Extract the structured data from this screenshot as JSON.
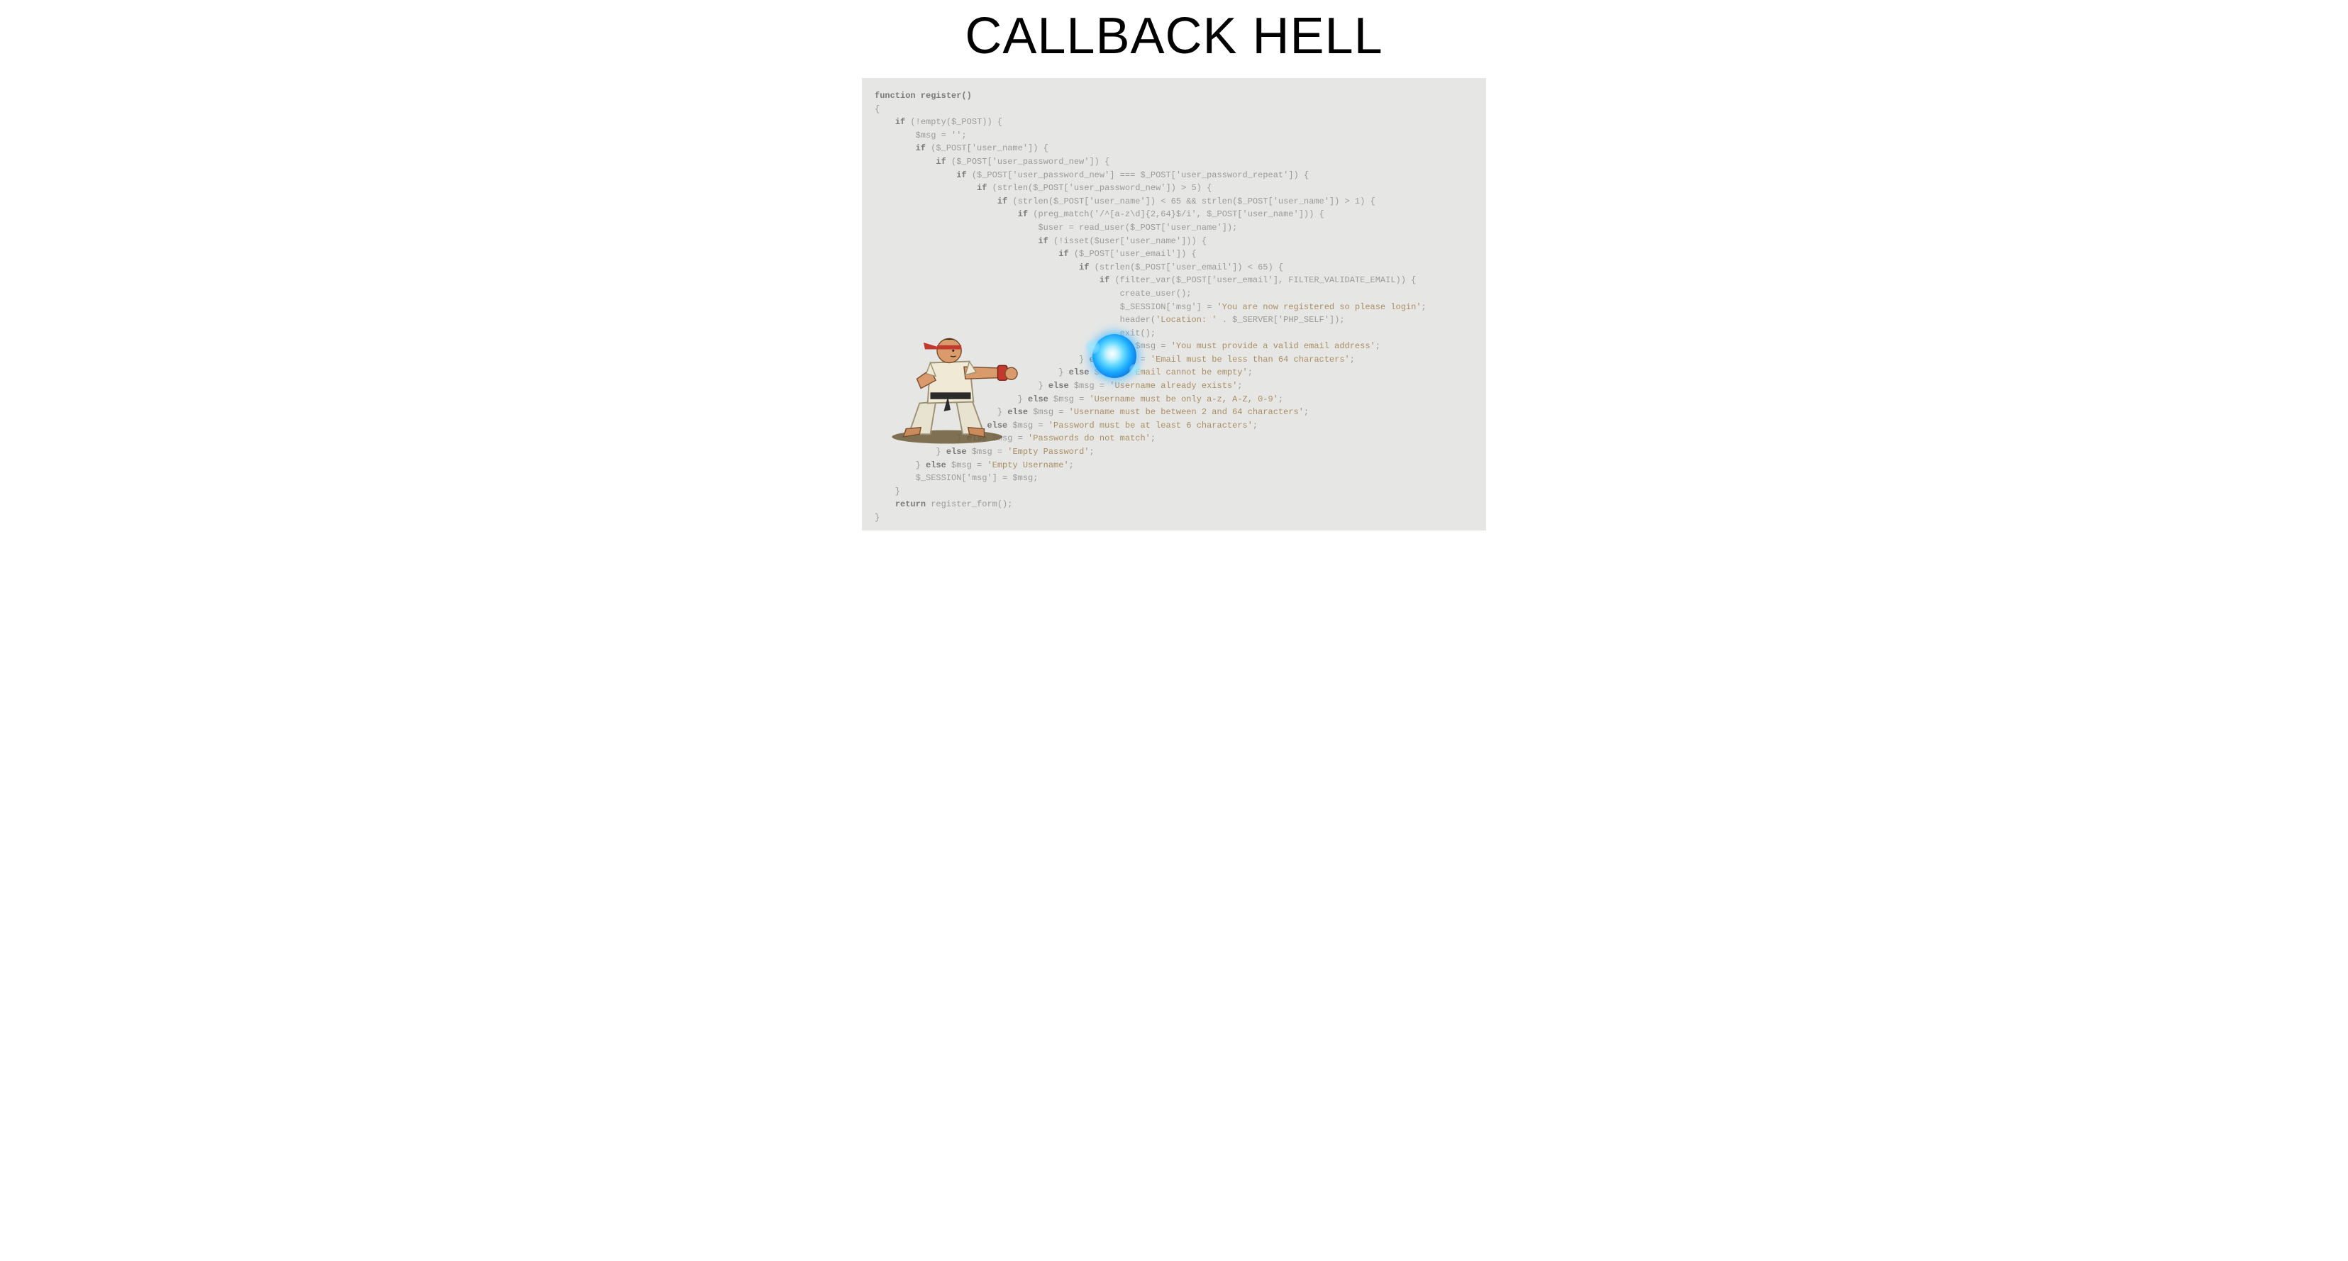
{
  "title": "CALLBACK HELL",
  "code": {
    "l01": "function register()",
    "l02": "{",
    "l03_kw": "if",
    "l03_rest": " (!empty($_POST)) {",
    "l04": "        $msg = '';",
    "l05_kw": "if",
    "l05_rest": " ($_POST['user_name']) {",
    "l06_kw": "if",
    "l06_rest": " ($_POST['user_password_new']) {",
    "l07_kw": "if",
    "l07_rest": " ($_POST['user_password_new'] === $_POST['user_password_repeat']) {",
    "l08_kw": "if",
    "l08_rest": " (strlen($_POST['user_password_new']) > 5) {",
    "l09_kw": "if",
    "l09_rest": " (strlen($_POST['user_name']) < 65 && strlen($_POST['user_name']) > 1) {",
    "l10_kw": "if",
    "l10_rest": " (preg_match('/^[a-z\\d]{2,64}$/i', $_POST['user_name'])) {",
    "l11": "                                $user = read_user($_POST['user_name']);",
    "l12_kw": "if",
    "l12_rest": " (!isset($user['user_name'])) {",
    "l13_kw": "if",
    "l13_rest": " ($_POST['user_email']) {",
    "l14_kw": "if",
    "l14_rest": " (strlen($_POST['user_email']) < 65) {",
    "l15_kw": "if",
    "l15_rest": " (filter_var($_POST['user_email'], FILTER_VALIDATE_EMAIL)) {",
    "l16": "                                                create_user();",
    "l17a": "                                                $_SESSION['msg'] = ",
    "l17b": "'You are now registered so please login'",
    "l17c": ";",
    "l18a": "                                                header(",
    "l18b": "'Location: '",
    "l18c": " . $_SERVER['PHP_SELF']);",
    "l19": "                                                exit();",
    "l20a": "                                            } ",
    "l20kw": "else",
    "l20b": " $msg = ",
    "l20s": "'You must provide a valid email address'",
    "l20e": ";",
    "l21a": "                                        } ",
    "l21kw": "else",
    "l21b": " $msg = ",
    "l21s": "'Email must be less than 64 characters'",
    "l21e": ";",
    "l22a": "                                    } ",
    "l22kw": "else",
    "l22b": " $msg = ",
    "l22s": "'Email cannot be empty'",
    "l22e": ";",
    "l23a": "                                } ",
    "l23kw": "else",
    "l23b": " $msg = ",
    "l23s": "'Username already exists'",
    "l23e": ";",
    "l24a": "                            } ",
    "l24kw": "else",
    "l24b": " $msg = ",
    "l24s": "'Username must be only a-z, A-Z, 0-9'",
    "l24e": ";",
    "l25a": "                        } ",
    "l25kw": "else",
    "l25b": " $msg = ",
    "l25s": "'Username must be between 2 and 64 characters'",
    "l25e": ";",
    "l26a": "                    } ",
    "l26kw": "else",
    "l26b": " $msg = ",
    "l26s": "'Password must be at least 6 characters'",
    "l26e": ";",
    "l27a": "                } ",
    "l27kw": "else",
    "l27b": " $msg = ",
    "l27s": "'Passwords do not match'",
    "l27e": ";",
    "l28a": "            } ",
    "l28kw": "else",
    "l28b": " $msg = ",
    "l28s": "'Empty Password'",
    "l28e": ";",
    "l29a": "        } ",
    "l29kw": "else",
    "l29b": " $msg = ",
    "l29s": "'Empty Username'",
    "l29e": ";",
    "l30": "        $_SESSION['msg'] = $msg;",
    "l31": "    }",
    "l32_kw": "return",
    "l32_rest": " register_form();",
    "l33": "}"
  },
  "graphics": {
    "character": "ryu-hadouken",
    "energy_ball": "hadouken-icon"
  }
}
